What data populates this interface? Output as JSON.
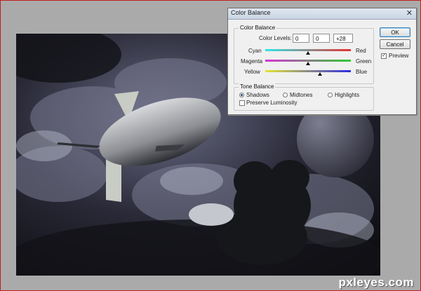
{
  "dialog": {
    "title": "Color Balance",
    "close_glyph": "✕",
    "color_balance_group": "Color Balance",
    "color_levels_label": "Color Levels:",
    "levels": [
      "0",
      "0",
      "+28"
    ],
    "sliders": [
      {
        "left": "Cyan",
        "right": "Red",
        "value": 0
      },
      {
        "left": "Magenta",
        "right": "Green",
        "value": 0
      },
      {
        "left": "Yellow",
        "right": "Blue",
        "value": 28
      }
    ],
    "tone_balance_group": "Tone Balance",
    "tones": [
      {
        "label": "Shadows",
        "selected": true
      },
      {
        "label": "Midtones",
        "selected": false
      },
      {
        "label": "Highlights",
        "selected": false
      }
    ],
    "preserve_label": "Preserve Luminosity",
    "preserve_checked": false,
    "ok_label": "OK",
    "cancel_label": "Cancel",
    "preview_label": "Preview",
    "preview_checked": true
  },
  "colors": {
    "cyan_red": [
      "#2ee6e6",
      "#e83030"
    ],
    "magenta_green": [
      "#d733d7",
      "#2ecb2e"
    ],
    "yellow_blue": [
      "#e6e62e",
      "#2c2ce0"
    ]
  },
  "watermark": "pxleyes.com"
}
